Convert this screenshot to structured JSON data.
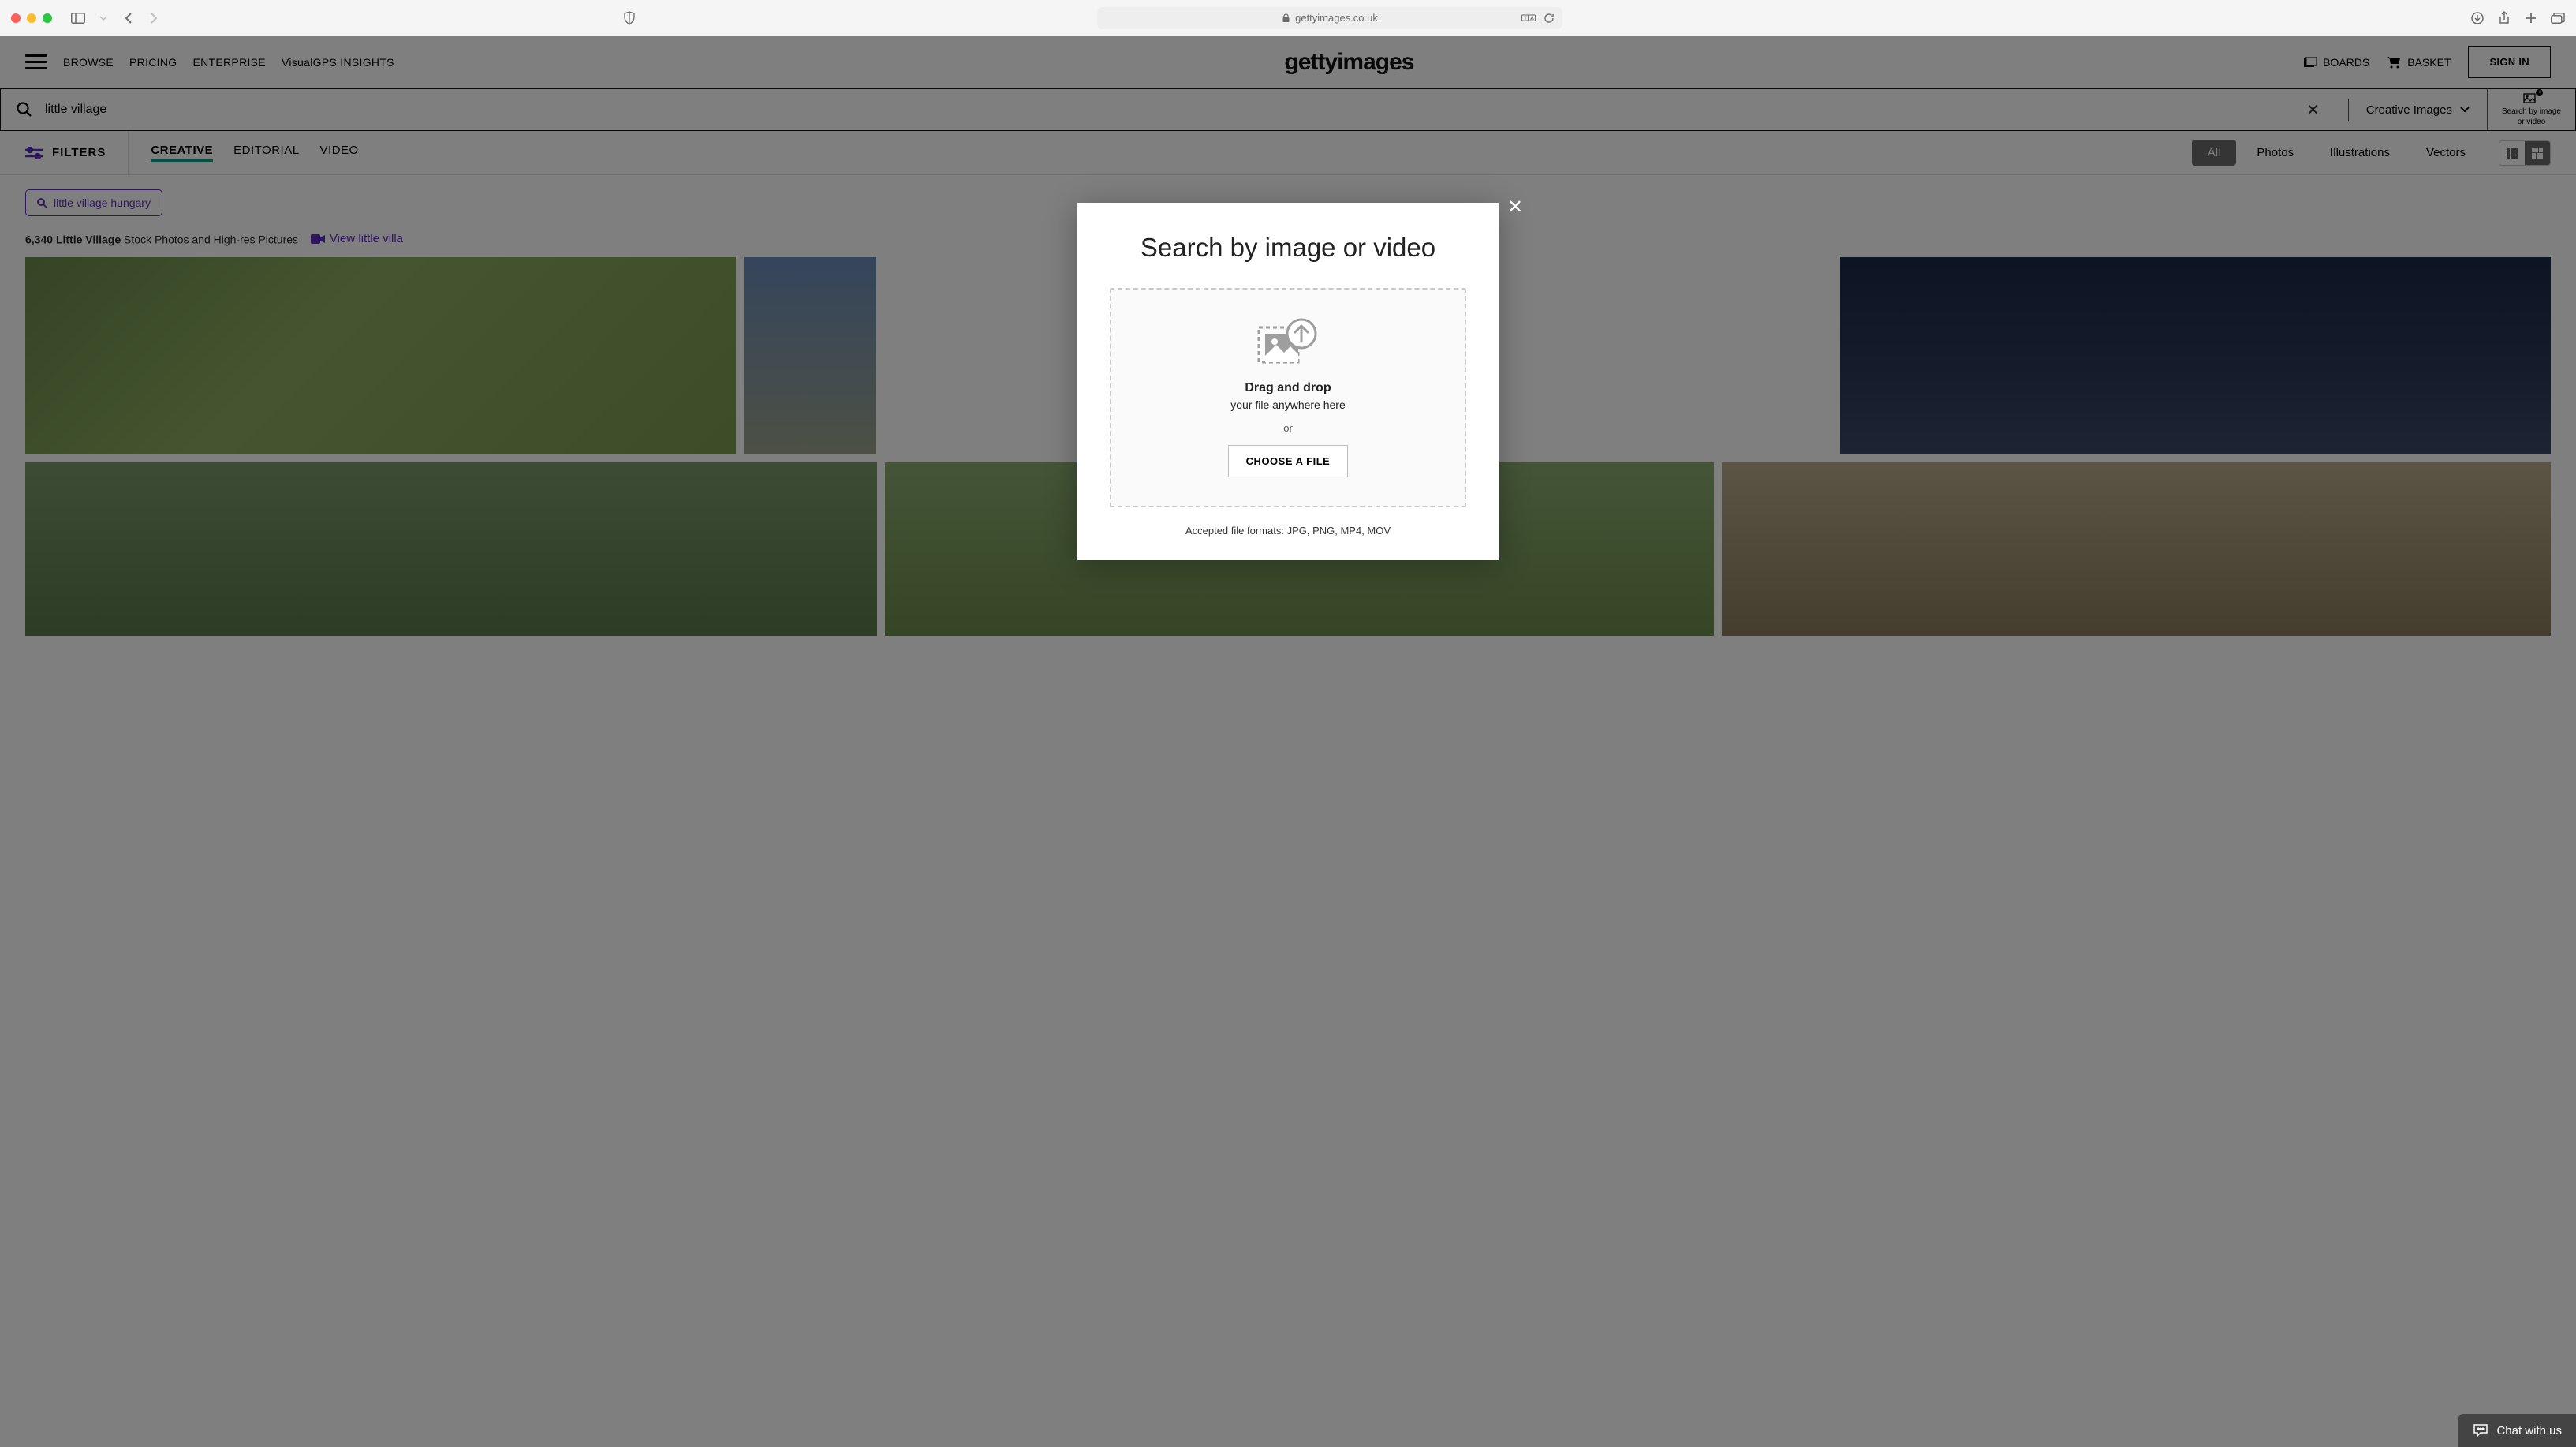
{
  "browser": {
    "url": "gettyimages.co.uk"
  },
  "nav": {
    "browse": "BROWSE",
    "pricing": "PRICING",
    "enterprise": "ENTERPRISE",
    "visualgps": "VisualGPS INSIGHTS",
    "logo": "gettyimages",
    "boards": "BOARDS",
    "basket": "BASKET",
    "signin": "SIGN IN"
  },
  "search": {
    "query": "little village",
    "type_label": "Creative Images",
    "sbi_line1": "Search by image",
    "sbi_line2": "or video"
  },
  "filters": {
    "button": "FILTERS",
    "tabs": {
      "creative": "CREATIVE",
      "editorial": "EDITORIAL",
      "video": "VIDEO"
    },
    "license": {
      "all": "All",
      "photos": "Photos",
      "illustrations": "Illustrations",
      "vectors": "Vectors"
    }
  },
  "chip": "little village hungary",
  "results": {
    "count": "6,340",
    "term": "Little Village",
    "suffix": " Stock Photos and High-res Pictures",
    "video_link": "View little villa"
  },
  "modal": {
    "title": "Search by image or video",
    "drag": "Drag and drop",
    "drag_sub": "your file anywhere here",
    "or": "or",
    "choose": "CHOOSE A FILE",
    "accepted": "Accepted file formats: JPG, PNG, MP4, MOV"
  },
  "chat": "Chat with us"
}
